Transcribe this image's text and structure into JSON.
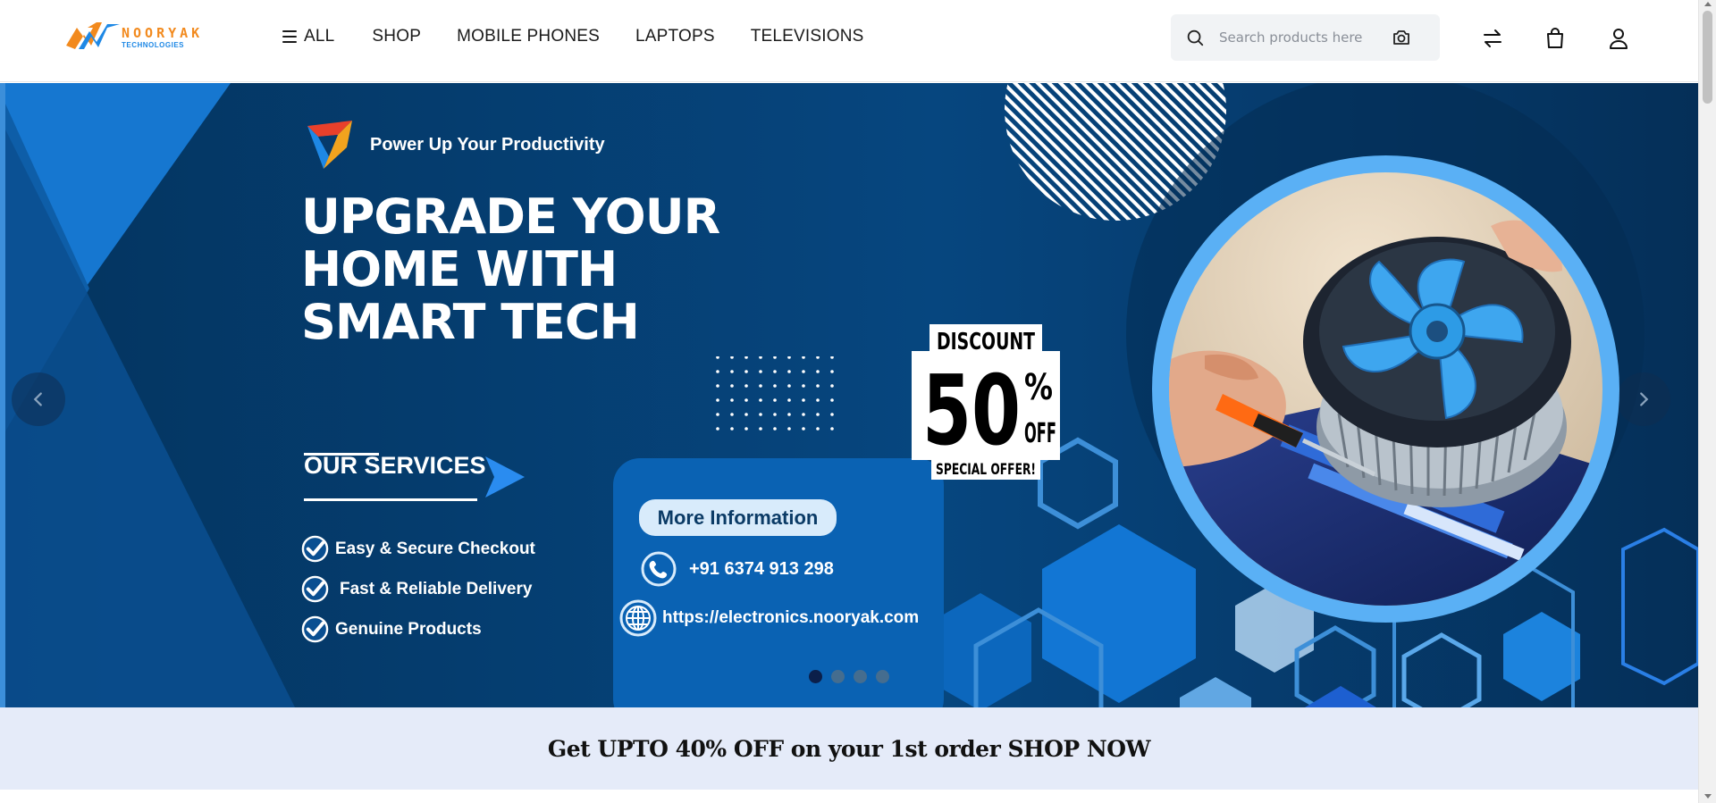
{
  "header": {
    "logo": {
      "name": "NOORYAK",
      "sub": "TECHNOLOGIES"
    },
    "nav": [
      {
        "label": "ALL"
      },
      {
        "label": "SHOP"
      },
      {
        "label": "MOBILE PHONES"
      },
      {
        "label": "LAPTOPS"
      },
      {
        "label": "TELEVISIONS"
      }
    ],
    "search": {
      "placeholder": "Search products here",
      "value": ""
    },
    "icons": [
      "search-icon",
      "camera-icon",
      "compare-icon",
      "shopping-bag-icon",
      "user-icon"
    ]
  },
  "banner": {
    "tagline": "Power Up Your Productivity",
    "headline": [
      "UPGRADE YOUR",
      "HOME WITH",
      "SMART TECH"
    ],
    "services_title": "OUR SERVICES",
    "services": [
      "Easy & Secure Checkout",
      "Fast & Reliable Delivery",
      "Genuine Products"
    ],
    "info_button": "More  Information",
    "phone": "+91 6374 913 298",
    "website": "https://electronics.nooryak.com",
    "discount": {
      "top": "DISCOUNT",
      "value": "50",
      "percent": "%",
      "off": "OFF",
      "bottom": "SPECIAL OFFER!"
    },
    "slides": {
      "total": 4,
      "active": 1
    },
    "colors": {
      "background": "#063a6b",
      "accent": "#1e88e5",
      "ring": "#5ab0f5"
    }
  },
  "promo": {
    "text": "Get UPTO 40% OFF on your 1st order SHOP NOW"
  }
}
